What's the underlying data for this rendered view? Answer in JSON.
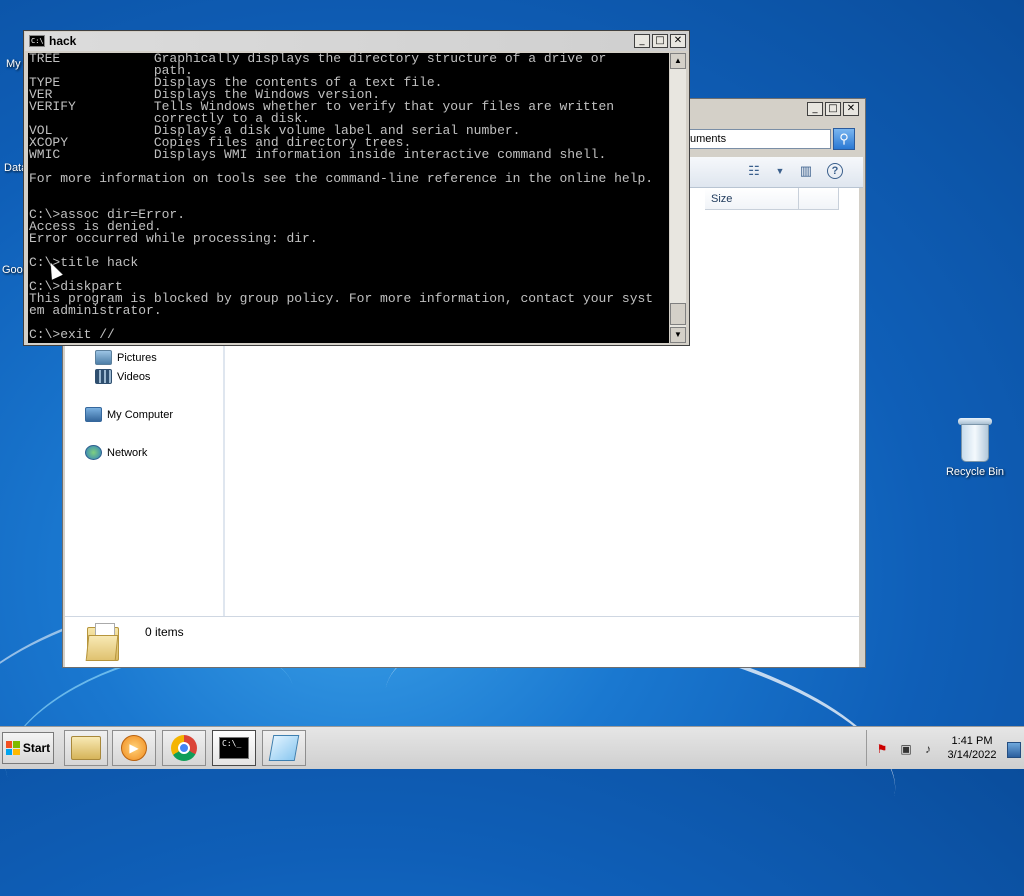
{
  "desktop": {
    "recycle_bin_label": "Recycle Bin",
    "partial_labels": [
      "My",
      "Data",
      "Goog"
    ]
  },
  "cmd": {
    "title": "hack",
    "console_text": "TREE            Graphically displays the directory structure of a drive or\n                path.\nTYPE            Displays the contents of a text file.\nVER             Displays the Windows version.\nVERIFY          Tells Windows whether to verify that your files are written\n                correctly to a disk.\nVOL             Displays a disk volume label and serial number.\nXCOPY           Copies files and directory trees.\nWMIC            Displays WMI information inside interactive command shell.\n\nFor more information on tools see the command-line reference in the online help.\n\n\nC:\\>assoc dir=Error.\nAccess is denied.\nError occurred while processing: dir.\n\nC:\\>title hack\n\nC:\\>diskpart\nThis program is blocked by group policy. For more information, contact your syst\nem administrator.\n\nC:\\>exit //"
  },
  "explorer": {
    "address_text": "uments",
    "column_size": "Size",
    "nav": {
      "pictures": "Pictures",
      "videos": "Videos",
      "my_computer": "My Computer",
      "network": "Network"
    },
    "details_text": "0 items"
  },
  "window_buttons": {
    "minimize": "_",
    "maximize": "□",
    "close": "✕"
  },
  "taskbar": {
    "start_label": "Start",
    "clock_time": "1:41 PM",
    "clock_date": "3/14/2022"
  },
  "colors": {
    "desktop_blue": "#1a78d0",
    "console_bg": "#000000",
    "console_fg": "#c0c0c0"
  }
}
